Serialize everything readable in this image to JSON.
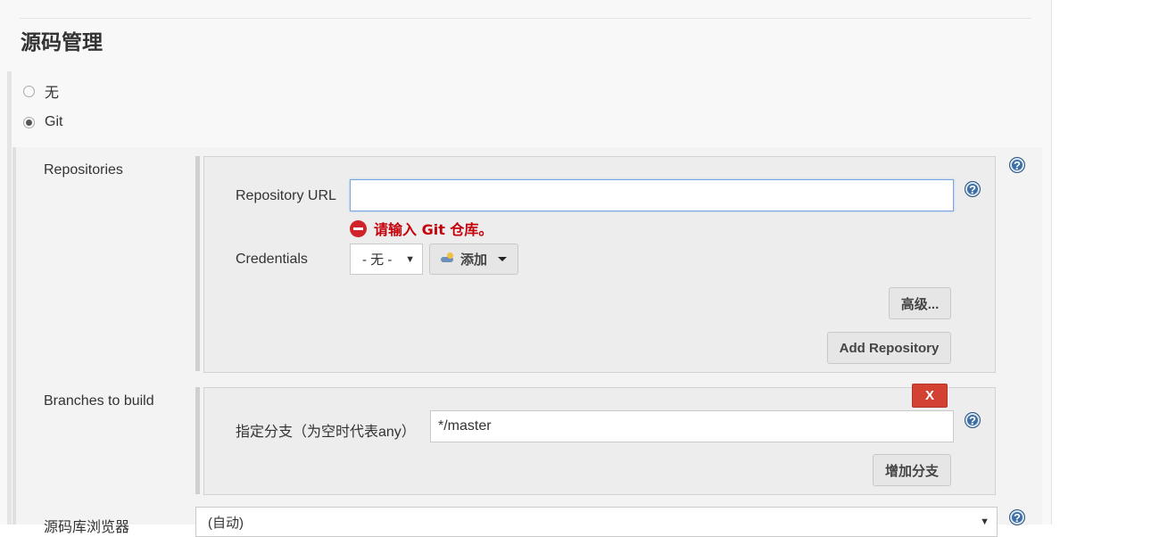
{
  "section": {
    "title": "源码管理"
  },
  "scm_options": [
    {
      "label": "无",
      "checked": false
    },
    {
      "label": "Git",
      "checked": true
    }
  ],
  "repositories": {
    "label": "Repositories",
    "url_label": "Repository URL",
    "url_value": "",
    "error_text": "请输入 Git 仓库。",
    "credentials_label": "Credentials",
    "credentials_selected": "- 无 -",
    "add_button_label": "添加",
    "advanced_button_label": "高级...",
    "add_repository_label": "Add Repository"
  },
  "branches": {
    "label": "Branches to build",
    "delete_label": "X",
    "specifier_label": "指定分支（为空时代表any）",
    "specifier_value": "*/master",
    "add_branch_label": "增加分支"
  },
  "repo_browser": {
    "label": "源码库浏览器",
    "selected": "(自动)"
  },
  "icons": {
    "help": "help-icon",
    "error": "error-icon",
    "credentials": "key-icon",
    "dropdown": "caret-down-icon"
  },
  "colors": {
    "error": "#c4000a",
    "delete_button": "#d24132",
    "help_icon": "#3d6fa6",
    "focus_border": "#7aa6e0"
  }
}
